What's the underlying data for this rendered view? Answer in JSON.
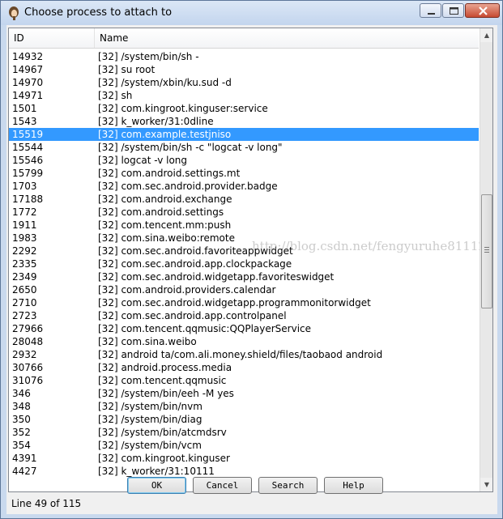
{
  "window": {
    "title": "Choose process to attach to"
  },
  "list": {
    "columns": [
      "ID",
      "Name"
    ],
    "selected_id": "15519",
    "rows": [
      {
        "id": "14932",
        "name": "[32] /system/bin/sh -"
      },
      {
        "id": "14967",
        "name": "[32] su root"
      },
      {
        "id": "14970",
        "name": "[32] /system/xbin/ku.sud -d"
      },
      {
        "id": "14971",
        "name": "[32] sh"
      },
      {
        "id": "1501",
        "name": "[32] com.kingroot.kinguser:service"
      },
      {
        "id": "1543",
        "name": "[32] k_worker/31:0dline"
      },
      {
        "id": "15519",
        "name": "[32] com.example.testjniso"
      },
      {
        "id": "15544",
        "name": "[32] /system/bin/sh -c \"logcat -v long\""
      },
      {
        "id": "15546",
        "name": "[32] logcat -v long"
      },
      {
        "id": "15799",
        "name": "[32] com.android.settings.mt"
      },
      {
        "id": "1703",
        "name": "[32] com.sec.android.provider.badge"
      },
      {
        "id": "17188",
        "name": "[32] com.android.exchange"
      },
      {
        "id": "1772",
        "name": "[32] com.android.settings"
      },
      {
        "id": "1911",
        "name": "[32] com.tencent.mm:push"
      },
      {
        "id": "1983",
        "name": "[32] com.sina.weibo:remote"
      },
      {
        "id": "2292",
        "name": "[32] com.sec.android.favoriteappwidget"
      },
      {
        "id": "2335",
        "name": "[32] com.sec.android.app.clockpackage"
      },
      {
        "id": "2349",
        "name": "[32] com.sec.android.widgetapp.favoriteswidget"
      },
      {
        "id": "2650",
        "name": "[32] com.android.providers.calendar"
      },
      {
        "id": "2710",
        "name": "[32] com.sec.android.widgetapp.programmonitorwidget"
      },
      {
        "id": "2723",
        "name": "[32] com.sec.android.app.controlpanel"
      },
      {
        "id": "27966",
        "name": "[32] com.tencent.qqmusic:QQPlayerService"
      },
      {
        "id": "28048",
        "name": "[32] com.sina.weibo"
      },
      {
        "id": "2932",
        "name": "[32] android ta/com.ali.money.shield/files/taobaod android"
      },
      {
        "id": "30766",
        "name": "[32] android.process.media"
      },
      {
        "id": "31076",
        "name": "[32] com.tencent.qqmusic"
      },
      {
        "id": "346",
        "name": "[32] /system/bin/eeh -M yes"
      },
      {
        "id": "348",
        "name": "[32] /system/bin/nvm"
      },
      {
        "id": "350",
        "name": "[32] /system/bin/diag"
      },
      {
        "id": "352",
        "name": "[32] /system/bin/atcmdsrv"
      },
      {
        "id": "354",
        "name": "[32] /system/bin/vcm"
      },
      {
        "id": "4391",
        "name": "[32] com.kingroot.kinguser"
      },
      {
        "id": "4427",
        "name": "[32] k_worker/31:10111"
      }
    ]
  },
  "watermark": "http://blog.csdn.net/fengyuruhe81112",
  "buttons": {
    "ok": "OK",
    "cancel": "Cancel",
    "search": "Search",
    "help": "Help"
  },
  "status": "Line 49 of 115",
  "colors": {
    "selection": "#3399ff",
    "titlebar": "#c9d9ee",
    "close_button": "#c74a32"
  }
}
